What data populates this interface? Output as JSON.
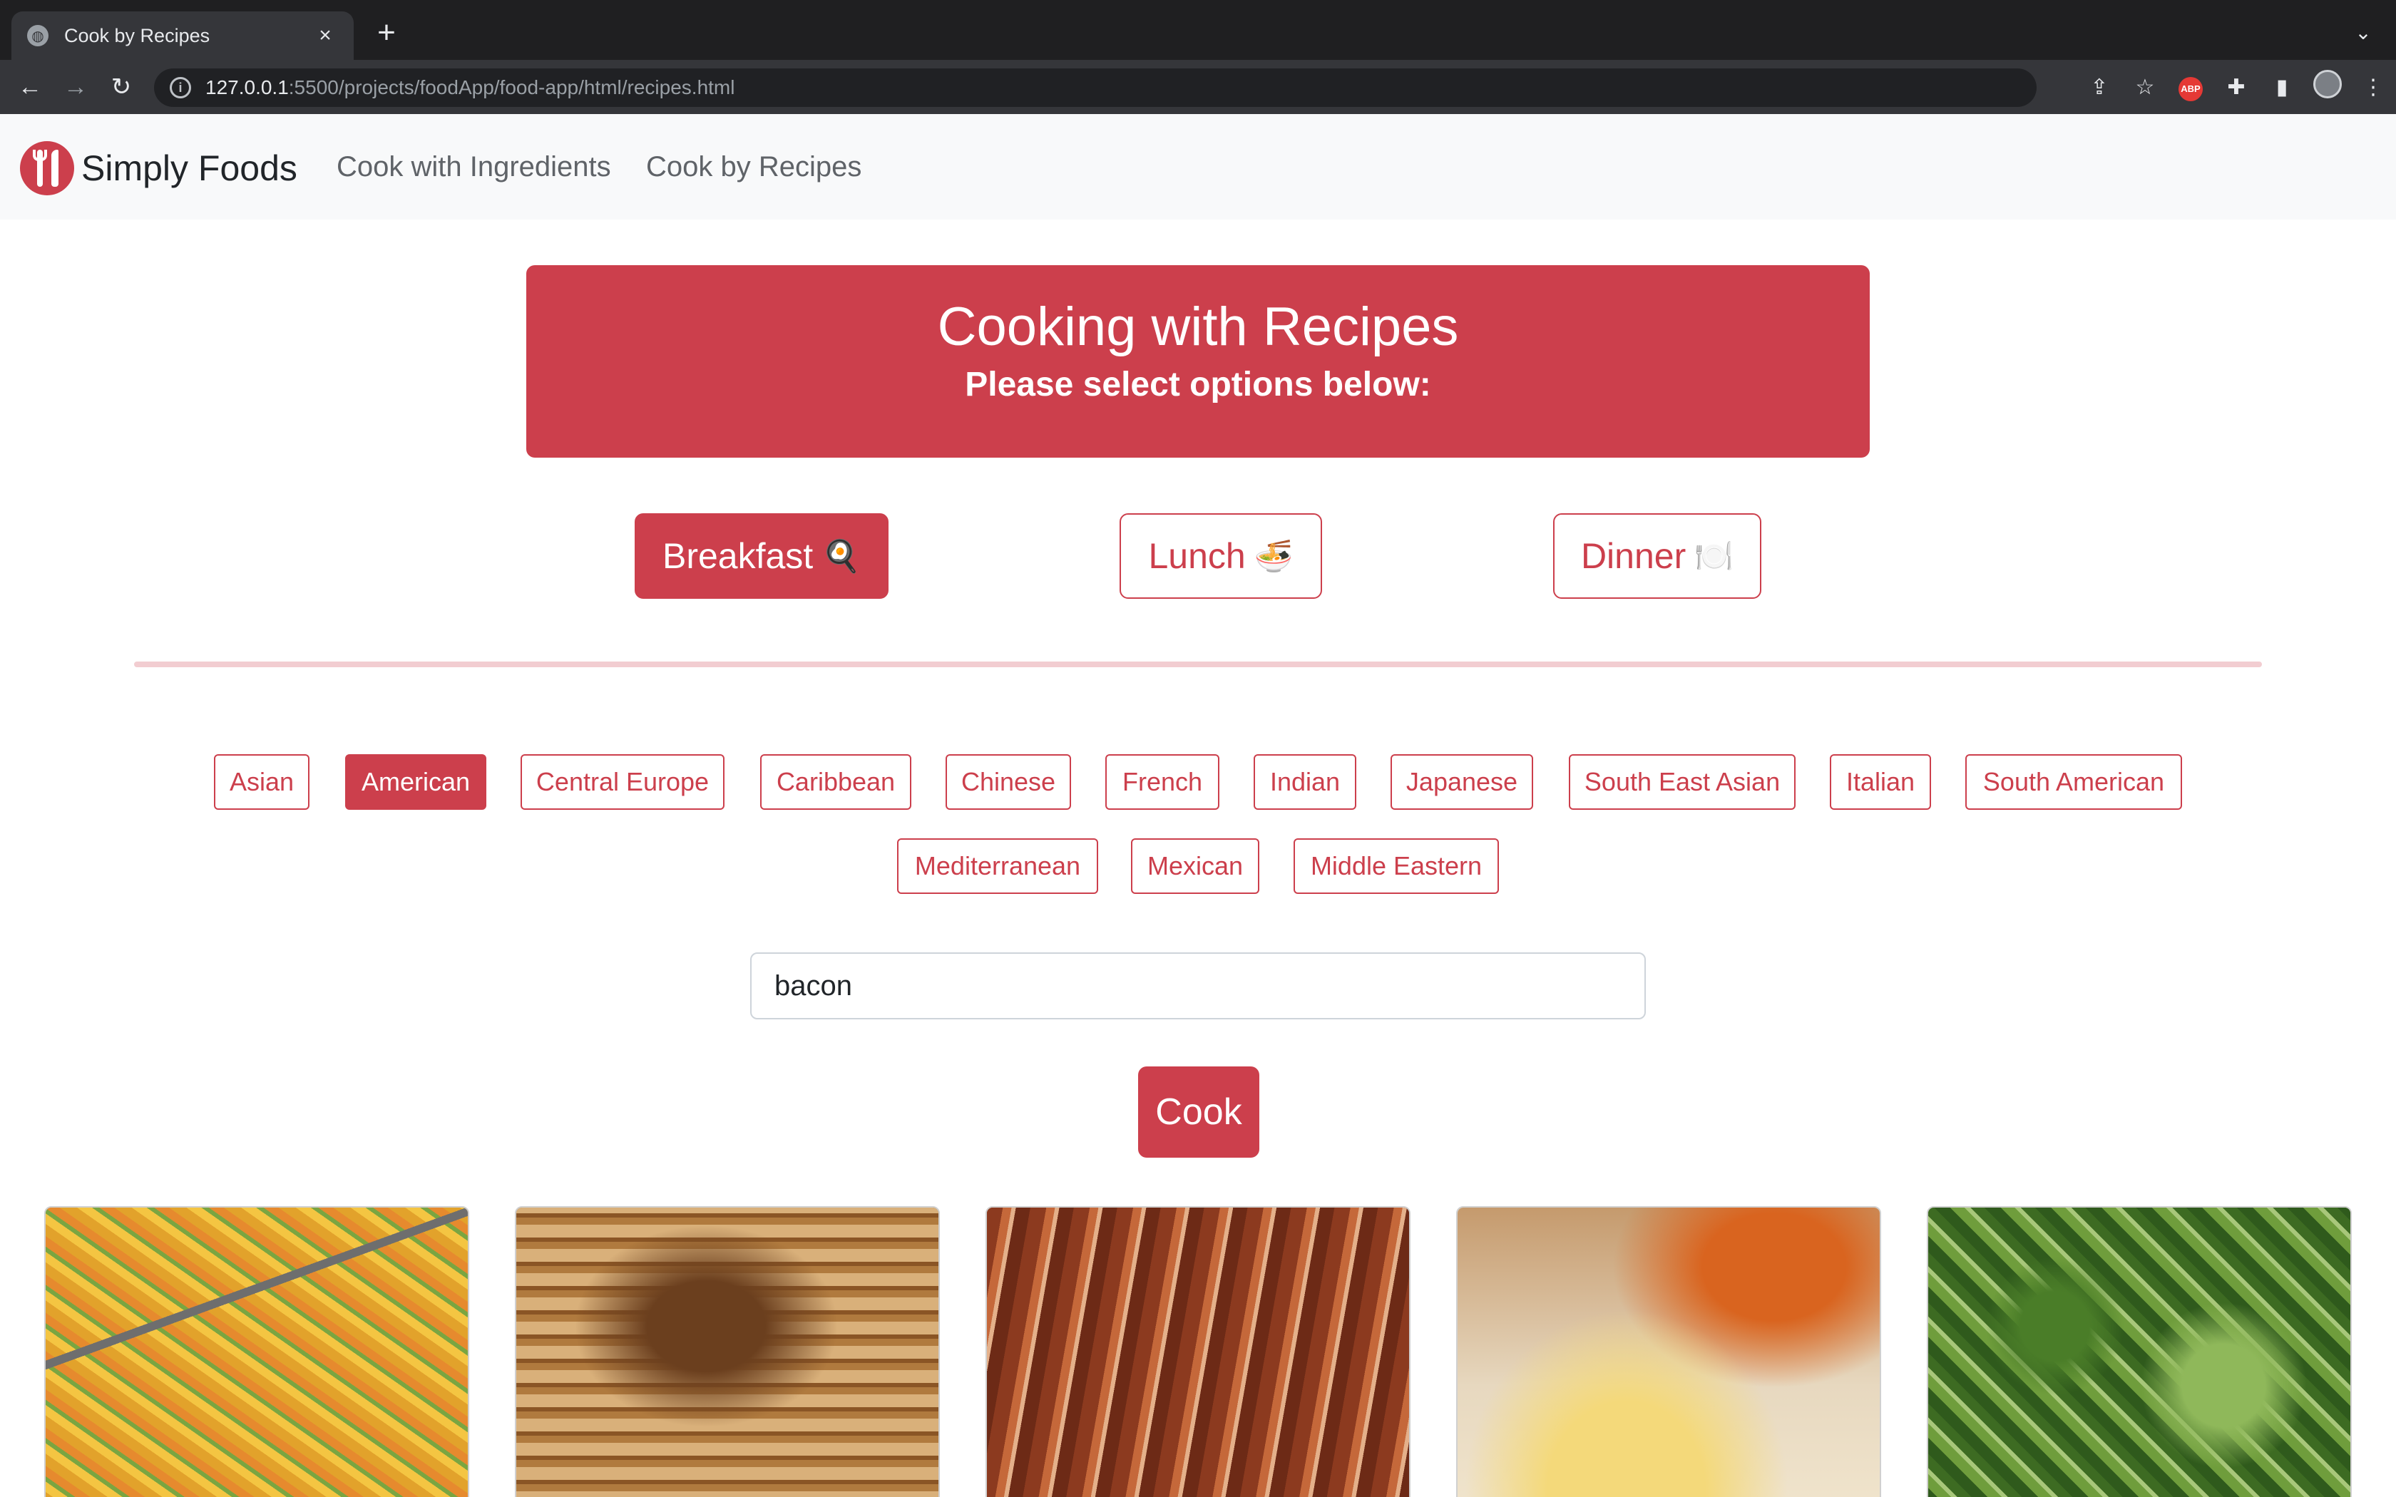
{
  "browser": {
    "tab_title": "Cook by Recipes",
    "url_host": "127.0.0.1",
    "url_path": ":5500/projects/foodApp/food-app/html/recipes.html"
  },
  "navbar": {
    "brand": "Simply Foods",
    "links": [
      "Cook with Ingredients",
      "Cook by Recipes"
    ]
  },
  "hero": {
    "title": "Cooking with Recipes",
    "subtitle": "Please select options below:"
  },
  "meals": [
    {
      "label": "Breakfast",
      "emoji": "🍳",
      "active": true
    },
    {
      "label": "Lunch",
      "emoji": "🍜",
      "active": false
    },
    {
      "label": "Dinner",
      "emoji": "🍽️",
      "active": false
    }
  ],
  "cuisines": [
    {
      "label": "Asian",
      "active": false
    },
    {
      "label": "American",
      "active": true
    },
    {
      "label": "Central Europe",
      "active": false
    },
    {
      "label": "Caribbean",
      "active": false
    },
    {
      "label": "Chinese",
      "active": false
    },
    {
      "label": "French",
      "active": false
    },
    {
      "label": "Indian",
      "active": false
    },
    {
      "label": "Japanese",
      "active": false
    },
    {
      "label": "South East Asian",
      "active": false
    },
    {
      "label": "Italian",
      "active": false
    },
    {
      "label": "South American",
      "active": false
    },
    {
      "label": "Mediterranean",
      "active": false
    },
    {
      "label": "Mexican",
      "active": false
    },
    {
      "label": "Middle Eastern",
      "active": false
    }
  ],
  "search": {
    "value": "bacon"
  },
  "cook_label": "Cook",
  "colors": {
    "accent": "#cc3f4c",
    "navbar_bg": "#f8f9fa",
    "divider": "#f2cdd1"
  }
}
